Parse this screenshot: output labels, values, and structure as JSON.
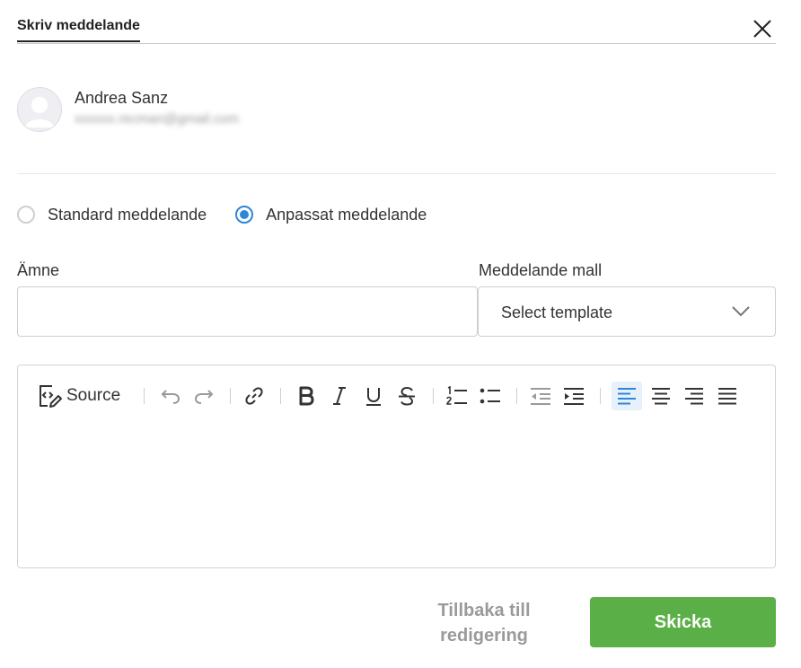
{
  "dialog": {
    "tab_label": "Skriv meddelande"
  },
  "recipient": {
    "name": "Andrea Sanz",
    "email": "xxxxxx.recman@gmail.com"
  },
  "message_type": {
    "options": [
      {
        "label": "Standard meddelande",
        "checked": false
      },
      {
        "label": "Anpassat meddelande",
        "checked": true
      }
    ]
  },
  "subject": {
    "label": "Ämne",
    "value": ""
  },
  "template": {
    "label": "Meddelande mall",
    "selected": "Select template"
  },
  "toolbar": {
    "source_label": "Source",
    "active": "align-left"
  },
  "actions": {
    "back_label": "Tillbaka till redigering",
    "send_label": "Skicka"
  },
  "colors": {
    "accent": "#2f86d8",
    "send": "#5ab046"
  }
}
